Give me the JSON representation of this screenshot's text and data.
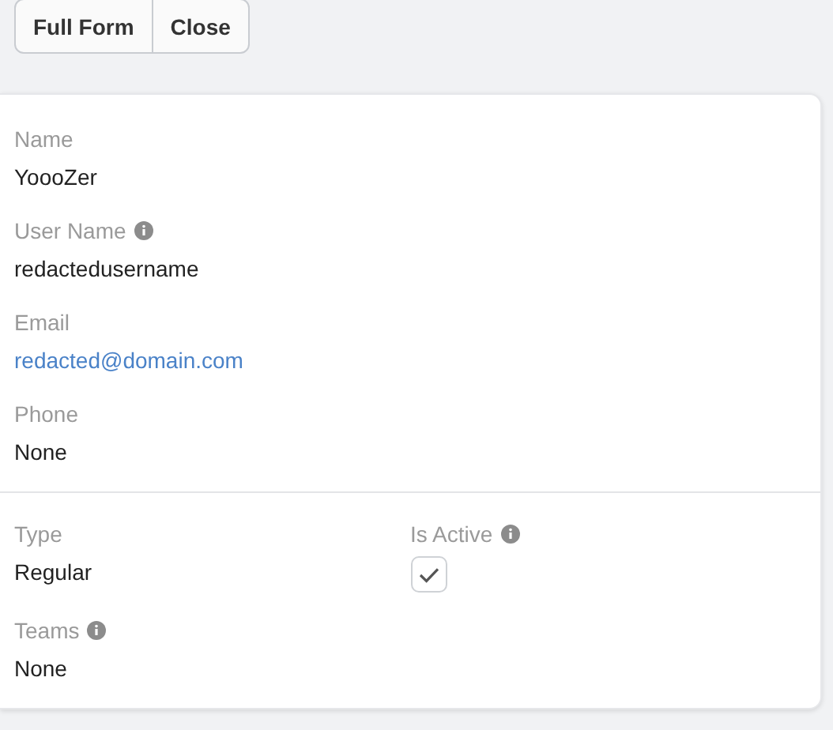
{
  "buttons": [
    "Full Form",
    "Close"
  ],
  "sections": [
    {
      "fields": [
        {
          "kind": "text",
          "label": "Name",
          "info": false,
          "value": "YoooZer"
        },
        {
          "kind": "text",
          "label": "User Name",
          "info": true,
          "value": "redactedusername"
        },
        {
          "kind": "link",
          "label": "Email",
          "info": false,
          "value": "redacted@domain.com"
        },
        {
          "kind": "text",
          "label": "Phone",
          "info": false,
          "value": "None"
        }
      ]
    },
    {
      "fields": [
        {
          "kind": "text",
          "label": "Type",
          "info": false,
          "value": "Regular"
        },
        {
          "kind": "checkbox",
          "label": "Is Active",
          "info": true,
          "checked": true
        },
        {
          "kind": "text",
          "label": "Teams",
          "info": true,
          "value": "None"
        }
      ]
    }
  ]
}
